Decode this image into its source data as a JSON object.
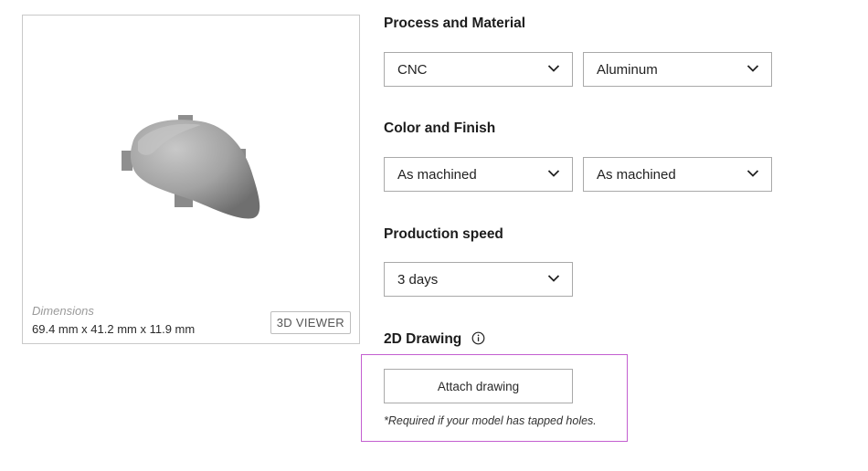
{
  "preview": {
    "dimensions_label": "Dimensions",
    "dimensions_value": "69.4 mm x 41.2 mm x 11.9 mm",
    "viewer_button": "3D VIEWER"
  },
  "process_material": {
    "title": "Process and Material",
    "process": "CNC",
    "material": "Aluminum"
  },
  "color_finish": {
    "title": "Color and Finish",
    "color": "As machined",
    "finish": "As machined"
  },
  "production_speed": {
    "title": "Production speed",
    "value": "3 days"
  },
  "drawing": {
    "title": "2D Drawing",
    "attach_button": "Attach drawing",
    "note": "*Required if your model has tapped holes."
  },
  "colors": {
    "highlight_border": "#c35fd0",
    "field_border": "#a9a9a9",
    "model_gray": "#9a9a9a"
  }
}
